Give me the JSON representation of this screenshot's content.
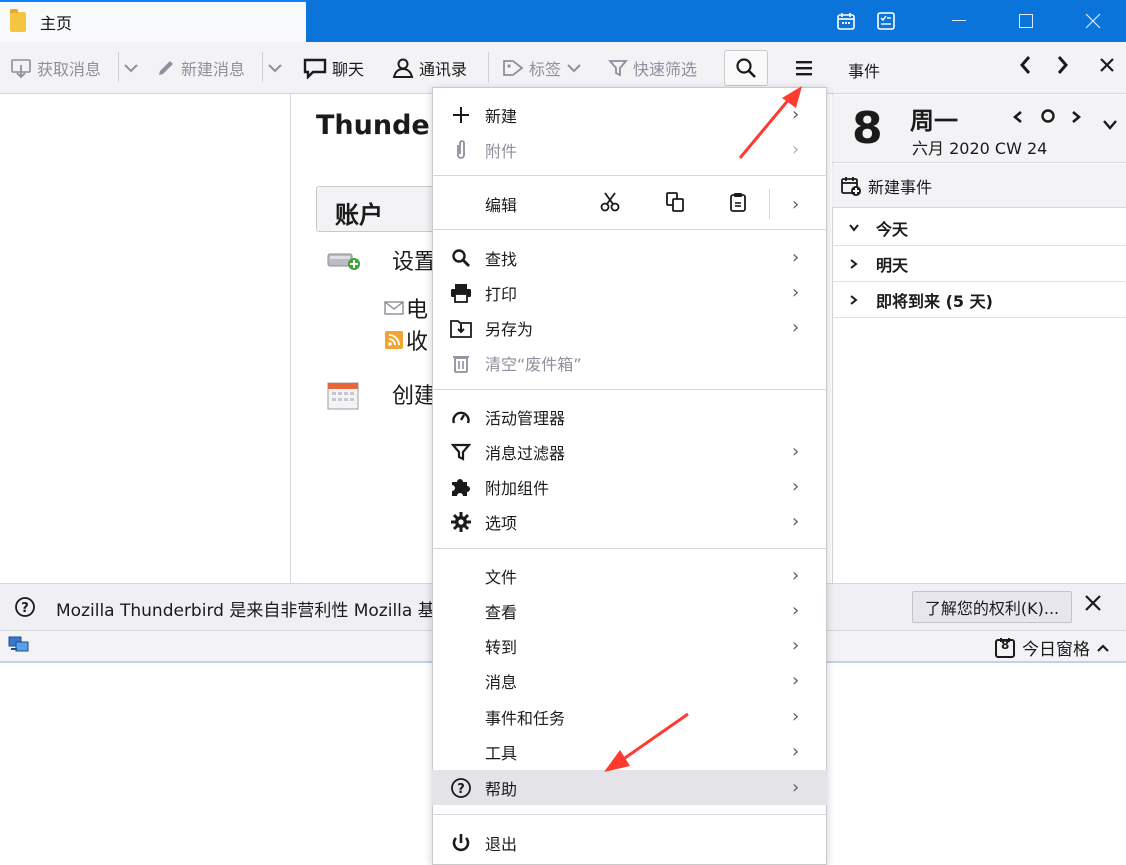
{
  "titlebar": {
    "tab_label": "主页"
  },
  "toolbar": {
    "get_messages": "获取消息",
    "new_message": "新建消息",
    "chat": "聊天",
    "address_book": "通讯录",
    "tags": "标签",
    "quick_filter": "快速筛选"
  },
  "content": {
    "title": "Thunder",
    "accounts": "账户",
    "setup": "设置",
    "email": "电",
    "feeds": "收",
    "create": "创建"
  },
  "notification": {
    "text": "Mozilla Thunderbird 是来自非营利性 Mozilla 基",
    "rights_button": "了解您的权利(K)..."
  },
  "statusbar": {
    "today_pane": "今日窗格",
    "today_day": "8"
  },
  "calendar": {
    "header": "事件",
    "day_number": "8",
    "weekday": "周一",
    "month_week": "六月 2020  CW 24",
    "new_event": "新建事件",
    "sections": [
      "今天",
      "明天",
      "即将到来 (5 天)"
    ]
  },
  "menu": {
    "new": "新建",
    "attach": "附件",
    "edit": "编辑",
    "find": "查找",
    "print": "打印",
    "save_as": "另存为",
    "empty_trash": "清空“废件箱”",
    "activity": "活动管理器",
    "filters": "消息过滤器",
    "addons": "附加组件",
    "options": "选项",
    "file": "文件",
    "view": "查看",
    "go": "转到",
    "message": "消息",
    "events_tasks": "事件和任务",
    "tools": "工具",
    "help": "帮助",
    "quit": "退出"
  },
  "colors": {
    "titlebar": "#0a74da",
    "annotation_arrow": "#ff3b30"
  }
}
